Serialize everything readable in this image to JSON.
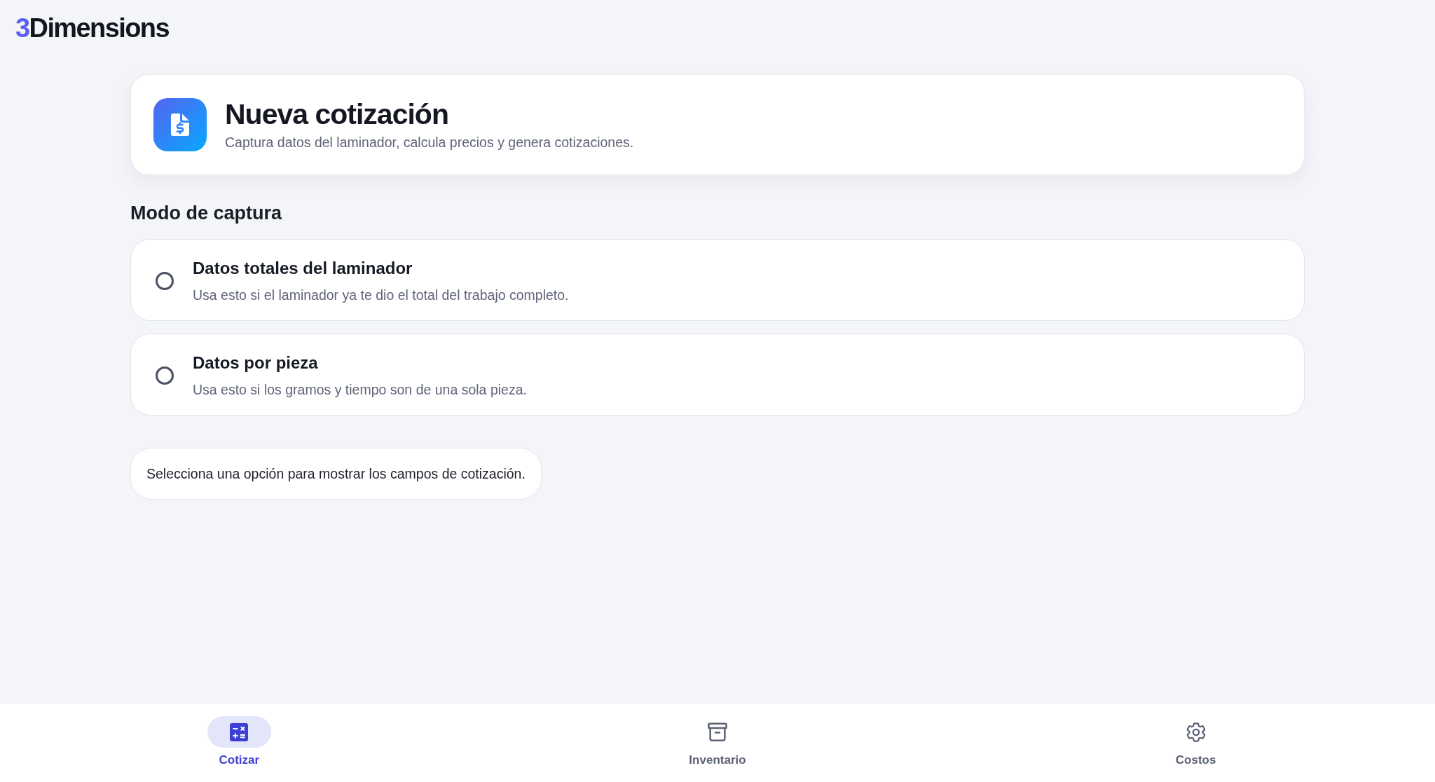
{
  "logo": {
    "accent": "3",
    "name": "Dimensions"
  },
  "header": {
    "title": "Nueva cotización",
    "subtitle": "Captura datos del laminador, calcula precios y genera cotizaciones."
  },
  "capture_mode": {
    "heading": "Modo de captura",
    "options": [
      {
        "title": "Datos totales del laminador",
        "description": "Usa esto si el laminador ya te dio el total del trabajo completo.",
        "selected": false
      },
      {
        "title": "Datos por pieza",
        "description": "Usa esto si los gramos y tiempo son de una sola pieza.",
        "selected": false
      }
    ]
  },
  "hint": "Selecciona una opción para mostrar los campos de cotización.",
  "bottom_nav": [
    {
      "label": "Cotizar",
      "selected": true
    },
    {
      "label": "Inventario",
      "selected": false
    },
    {
      "label": "Costos",
      "selected": false
    }
  ]
}
